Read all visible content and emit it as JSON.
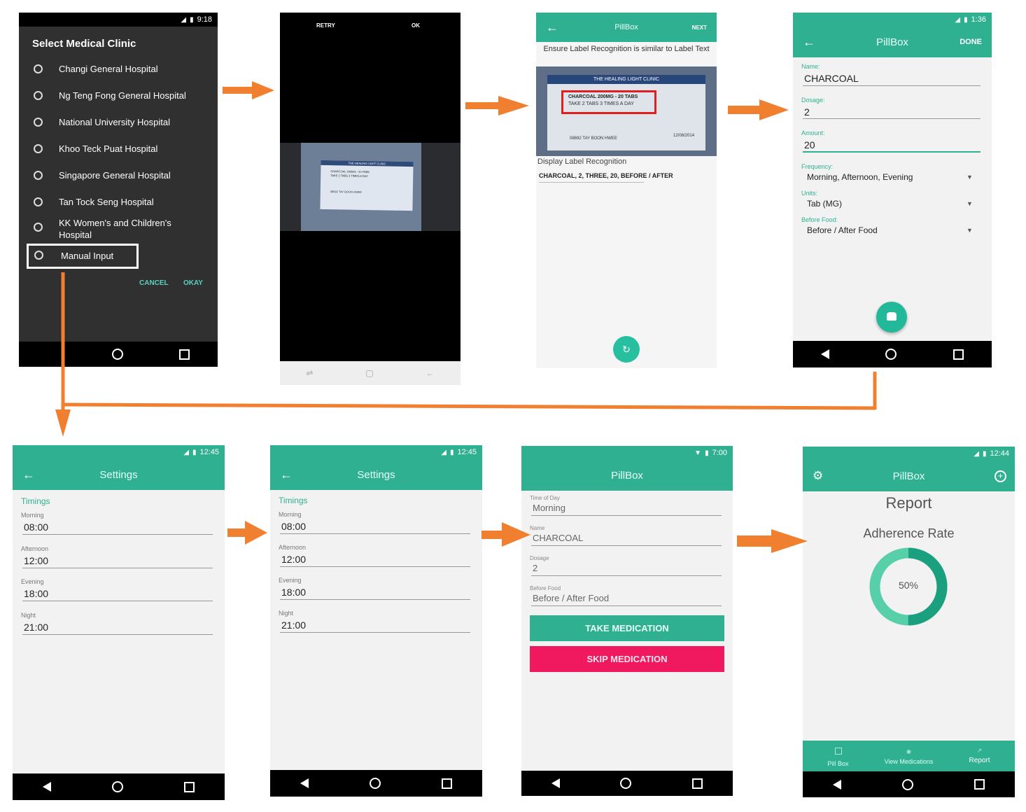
{
  "screen1": {
    "status_time": "9:18",
    "title": "Select Medical Clinic",
    "options": [
      "Changi General Hospital",
      "Ng Teng Fong General Hospital",
      "National University Hospital",
      "Khoo Teck Puat Hospital",
      "Singapore General Hospital",
      "Tan Tock Seng Hospital",
      "KK Women's and Children's Hospital",
      "Manual Input"
    ],
    "cancel_label": "CANCEL",
    "okay_label": "OKAY"
  },
  "screen2": {
    "retry_label": "RETRY",
    "ok_label": "OK",
    "photo_clinic": "THE HEALING LIGHT CLINIC",
    "photo_line1": "CHARCOAL 200MG - 20 TABS",
    "photo_line2": "TAKE 2 TABS 3 TIMES A DAY",
    "photo_patient": "08692 TAY BOON HWEE"
  },
  "screen3": {
    "title": "PillBox",
    "next_label": "NEXT",
    "instruction": "Ensure Label Recognition is similar to Label Text",
    "photo_clinic": "THE HEALING LIGHT CLINIC",
    "photo_line1": "CHARCOAL 200MG - 20 TABS",
    "photo_line2": "TAKE 2 TABS 3 TIMES A DAY",
    "photo_patient": "08692 TAY BOON HWEE",
    "photo_date": "12/08/2014",
    "recognition_label": "Display Label Recognition",
    "recognition_text": "CHARCOAL, 2, THREE, 20, BEFORE / AFTER"
  },
  "screen4": {
    "status_time": "1:36",
    "title": "PillBox",
    "done_label": "DONE",
    "name_label": "Name:",
    "name_value": "CHARCOAL",
    "dosage_label": "Dosage:",
    "dosage_value": "2",
    "amount_label": "Amount:",
    "amount_value": "20",
    "frequency_label": "Frequency:",
    "frequency_value": "Morning, Afternoon, Evening",
    "units_label": "Units:",
    "units_value": "Tab (MG)",
    "before_food_label": "Before Food:",
    "before_food_value": "Before / After Food"
  },
  "settings": {
    "status_time": "12:45",
    "title": "Settings",
    "section": "Timings",
    "timings": [
      {
        "label": "Morning",
        "value": "08:00"
      },
      {
        "label": "Afternoon",
        "value": "12:00"
      },
      {
        "label": "Evening",
        "value": "18:00"
      },
      {
        "label": "Night",
        "value": "21:00"
      }
    ]
  },
  "screen7": {
    "status_time": "7:00",
    "title": "PillBox",
    "time_label": "Time of Day",
    "time_value": "Morning",
    "name_label": "Name",
    "name_value": "CHARCOAL",
    "dosage_label": "Dosage",
    "dosage_value": "2",
    "before_food_label": "Before Food",
    "before_food_value": "Before / After Food",
    "take_label": "TAKE MEDICATION",
    "skip_label": "SKIP MEDICATION"
  },
  "screen8": {
    "status_time": "12:44",
    "title": "PillBox",
    "heading": "Report",
    "subheading": "Adherence Rate",
    "adherence_percent_text": "50%",
    "adherence_fraction": 0.5,
    "tabs": [
      "Pill Box",
      "View Medications",
      "Report"
    ]
  },
  "colors": {
    "accent": "#2fb191",
    "dark_dialog": "#303030",
    "arrow": "#f08030",
    "skip": "#f0185f",
    "dialog_button": "#5ad1c0"
  }
}
